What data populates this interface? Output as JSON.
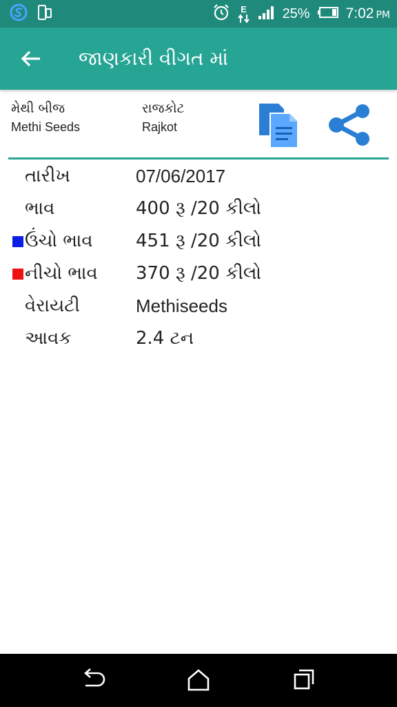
{
  "status_bar": {
    "network_type": "E",
    "battery": "25%",
    "time": "7:02",
    "ampm": "PM"
  },
  "app_bar": {
    "title": "જાણકારી વીગત માં"
  },
  "header": {
    "commodity_gu": "મેથી બીજ",
    "commodity_en": "Methi Seeds",
    "market_gu": "રાજકોટ",
    "market_en": "Rajkot"
  },
  "details": [
    {
      "label": "તારીખ",
      "value": "07/06/2017"
    },
    {
      "label": "ભાવ",
      "value": "400 રૂ /20 કીલો"
    },
    {
      "label": "ઉંચો ભાવ",
      "value": "451 રૂ /20 કીલો",
      "marker_color": "#0a1ee6"
    },
    {
      "label": "નીચો ભાવ",
      "value": "370 રૂ /20 કીલો",
      "marker_color": "#ee1111"
    },
    {
      "label": "વેરાયટી",
      "value": "Methiseeds"
    },
    {
      "label": "આવક",
      "value": "2.4 ટન"
    }
  ],
  "colors": {
    "status_bar": "#1f8a7b",
    "app_bar": "#26a595",
    "accent_blue": "#2a7fd4",
    "high_marker": "#0a1ee6",
    "low_marker": "#ee1111"
  },
  "icons": {
    "status_left": [
      "s-app-icon",
      "phone-icon"
    ],
    "status_right": [
      "alarm-icon",
      "data-arrows-icon",
      "signal-icon",
      "battery-icon"
    ],
    "actions": [
      "copy-icon",
      "share-icon"
    ],
    "navigation": [
      "nav-back-icon",
      "nav-home-icon",
      "nav-recents-icon"
    ]
  }
}
